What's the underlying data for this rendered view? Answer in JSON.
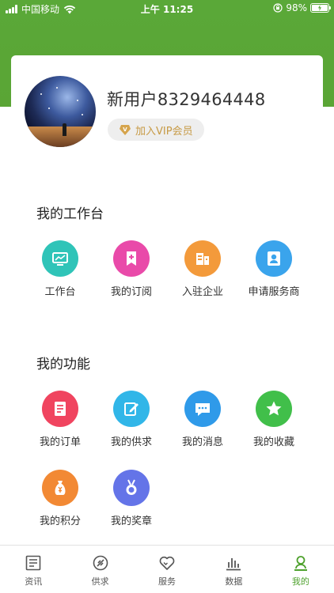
{
  "status_bar": {
    "carrier": "中国移动",
    "time": "上午 11:25",
    "battery": "98%"
  },
  "profile": {
    "username": "新用户8329464448",
    "vip_label": "加入VIP会员"
  },
  "workbench": {
    "title": "我的工作台",
    "items": [
      {
        "label": "工作台",
        "icon": "monitor-chart-icon",
        "color": "#2fc4b8"
      },
      {
        "label": "我的订阅",
        "icon": "bookmark-plus-icon",
        "color": "#e94aa9"
      },
      {
        "label": "入驻企业",
        "icon": "building-icon",
        "color": "#f39a3b"
      },
      {
        "label": "申请服务商",
        "icon": "user-badge-icon",
        "color": "#3aa4ec"
      }
    ]
  },
  "functions": {
    "title": "我的功能",
    "items": [
      {
        "label": "我的订单",
        "icon": "order-list-icon",
        "color": "#f0445f"
      },
      {
        "label": "我的供求",
        "icon": "edit-icon",
        "color": "#31b6e8"
      },
      {
        "label": "我的消息",
        "icon": "message-icon",
        "color": "#2f9ae9"
      },
      {
        "label": "我的收藏",
        "icon": "star-icon",
        "color": "#41bf4a"
      },
      {
        "label": "我的积分",
        "icon": "money-bag-icon",
        "color": "#f28934"
      },
      {
        "label": "我的奖章",
        "icon": "medal-icon",
        "color": "#6474e8"
      }
    ]
  },
  "tabbar": {
    "items": [
      {
        "label": "资讯",
        "icon": "news-icon"
      },
      {
        "label": "供求",
        "icon": "supply-icon"
      },
      {
        "label": "服务",
        "icon": "heart-icon"
      },
      {
        "label": "数据",
        "icon": "bar-chart-icon"
      },
      {
        "label": "我的",
        "icon": "person-icon",
        "active": true
      }
    ],
    "active_color": "#4ea12d"
  }
}
